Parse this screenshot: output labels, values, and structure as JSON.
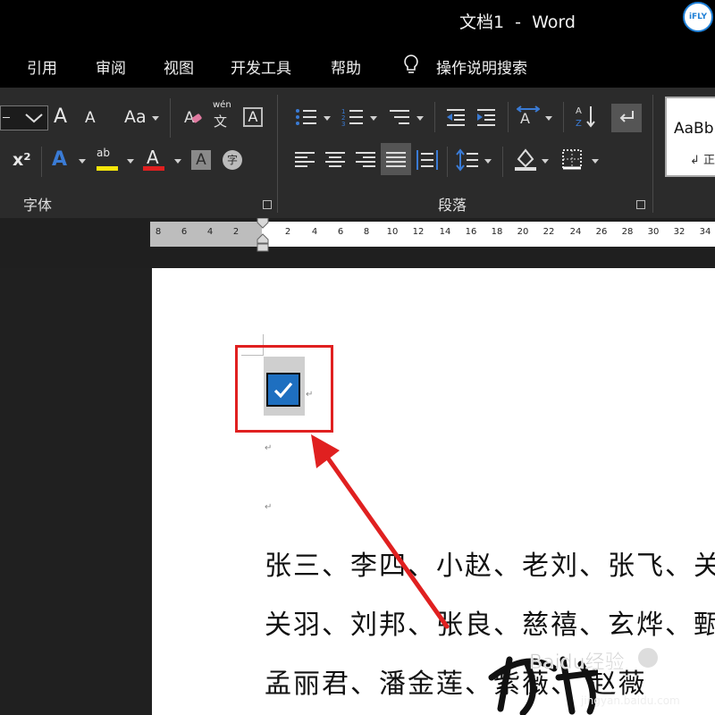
{
  "titlebar": {
    "doc_title": "文档1  -  Word",
    "badge": "iFLY"
  },
  "menu": [
    "引用",
    "审阅",
    "视图",
    "开发工具",
    "帮助",
    "操作说明搜索"
  ],
  "ribbon": {
    "font_group_label": "字体",
    "paragraph_group_label": "段落",
    "styles_preview": "AaBb",
    "styles_name_partial": "↲ 正",
    "font_buttons": {
      "grow": "A",
      "shrink": "A",
      "change_case": "Aa",
      "phonetic_top": "wén",
      "phonetic_bottom": "文",
      "char_border": "A",
      "superscript": "x²",
      "text_effects": "A",
      "highlight": "ab",
      "font_color": "A",
      "char_shading": "A",
      "enclose": "字"
    },
    "colors": {
      "highlight": "#f5e50a",
      "font_color": "#e02020",
      "accent": "#1e6fc0"
    }
  },
  "ruler": {
    "ticks": [
      "8",
      "6",
      "4",
      "2",
      "2",
      "4",
      "6",
      "8",
      "10",
      "12",
      "14",
      "16",
      "18",
      "20",
      "22",
      "24",
      "26",
      "28",
      "30",
      "32",
      "34"
    ]
  },
  "document": {
    "checkbox_checked": true,
    "paragraph_mark": "↵",
    "lines": [
      "张三、李四、小赵、老刘、张飞、关",
      "关羽、刘邦、张良、慈禧、玄烨、甄",
      "孟丽君、潘金莲、紫薇、       赵薇"
    ]
  },
  "watermark": {
    "text": "Baidu经验",
    "sub": "jingyan.baidu.com"
  }
}
